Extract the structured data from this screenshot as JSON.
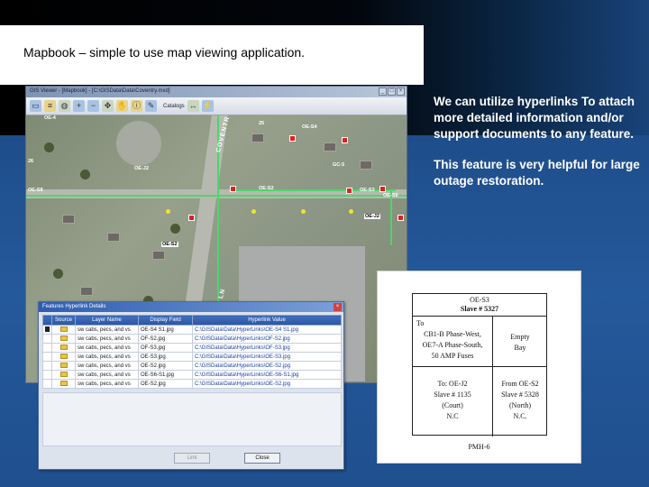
{
  "slide": {
    "title": "Mapbook – simple to use map viewing application.",
    "side_paragraphs": [
      "We can utilize hyperlinks To attach more detailed information and/or support  documents to any feature.",
      "This feature is very helpful for large outage restoration."
    ]
  },
  "app": {
    "title": "GIS Viewer - [Mapbook] - [C:\\GISData\\Data\\Coventry.mxd]",
    "window_controls": [
      "_",
      "□",
      "×"
    ],
    "toolbar": {
      "catalogs_label": "Catalogs"
    },
    "map": {
      "street_labels": [
        "COVENTRY CT",
        "COVENTRY LN"
      ],
      "feature_labels": [
        "25",
        "26",
        "OE-4",
        "OE-S4",
        "OE-S8",
        "OE-S2",
        "OE-S3",
        "OE-J2",
        "OE-S6",
        "GC-5"
      ],
      "callout_labels": [
        "OE-J2",
        "OE-S2"
      ]
    }
  },
  "dialog": {
    "title": "Features Hyperlink Details",
    "columns": [
      "Source",
      "Layer Name",
      "Display Field",
      "Hyperlink Value"
    ],
    "rows": [
      {
        "layer": "sw cabs, pecs, and vs",
        "display": "OE-S4 S1.jpg",
        "link": "C:\\GISData\\Data\\HyperLinks\\OE-S4 S1.jpg"
      },
      {
        "layer": "sw cabs, pecs, and vs",
        "display": "OF-S2.jpg",
        "link": "C:\\GISData\\Data\\HyperLinks\\OF-S2.jpg"
      },
      {
        "layer": "sw cabs, pecs, and vs",
        "display": "OF-S3.jpg",
        "link": "C:\\GISData\\Data\\HyperLinks\\OF-S3.jpg"
      },
      {
        "layer": "sw cabs, pecs, and vs",
        "display": "OE-S3.jpg",
        "link": "C:\\GISData\\Data\\HyperLinks\\OE-S3.jpg"
      },
      {
        "layer": "sw cabs, pecs, and vs",
        "display": "OE-S2.jpg",
        "link": "C:\\GISData\\Data\\HyperLinks\\OE-S2.jpg"
      },
      {
        "layer": "sw cabs, pecs, and vs",
        "display": "OE-S6-S1.jpg",
        "link": "C:\\GISData\\Data\\HyperLinks\\OE-S6-S1.jpg"
      },
      {
        "layer": "sw cabs, pecs, and vs",
        "display": "OE-S2.jpg",
        "link": "C:\\GISData\\Data\\HyperLinks\\OE-S2.jpg"
      }
    ],
    "link_button": "Link",
    "close_button": "Close"
  },
  "document": {
    "header_line1": "OE-S3",
    "header_line2": "Slave # 5327",
    "to_label": "To",
    "left_top": [
      "CB1-B Phase-West,",
      "OE7-A Phase-South,",
      "50 AMP Fuses"
    ],
    "right_top": [
      "Empty",
      "Bay"
    ],
    "left_bottom": [
      "To: OE-J2",
      "Slave # 1135",
      "(Court)",
      "N.C"
    ],
    "right_bottom": [
      "From OE-S2",
      "Slave # 5328",
      "(North)",
      "N.C."
    ],
    "footer": "PMH-6"
  }
}
